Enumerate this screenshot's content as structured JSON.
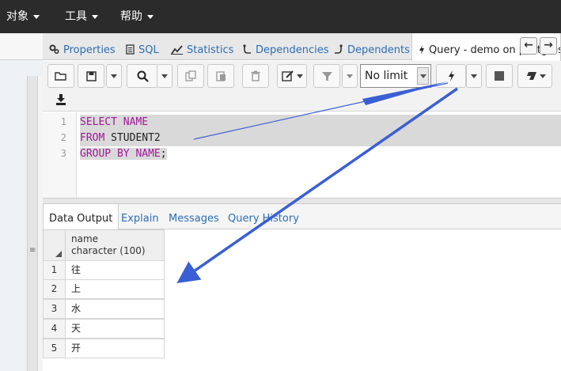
{
  "menu": [
    {
      "label": "对象"
    },
    {
      "label": "工具"
    },
    {
      "label": "帮助"
    }
  ],
  "tabs": [
    {
      "label": "Properties",
      "icon": "properties-icon"
    },
    {
      "label": "SQL",
      "icon": "sql-icon"
    },
    {
      "label": "Statistics",
      "icon": "statistics-icon"
    },
    {
      "label": "Dependencies",
      "icon": "dependencies-icon"
    },
    {
      "label": "Dependents",
      "icon": "dependents-icon"
    },
    {
      "label": "Query - demo on postgres",
      "icon": "query-bolt-icon",
      "active": true
    }
  ],
  "toolbar": {
    "limit_value": "No limit"
  },
  "editor": {
    "lines": [
      {
        "num": "1",
        "tokens": [
          {
            "text": "SELECT",
            "kind": "kw"
          },
          {
            "text": " NAME",
            "kind": "kw"
          }
        ]
      },
      {
        "num": "2",
        "tokens": [
          {
            "text": "FROM",
            "kind": "kw"
          },
          {
            "text": " STUDENT2",
            "kind": "id"
          }
        ]
      },
      {
        "num": "3",
        "tokens": [
          {
            "text": "GROUP BY NAME",
            "kind": "kw"
          },
          {
            "text": ";",
            "kind": "id"
          }
        ]
      }
    ]
  },
  "output_tabs": [
    {
      "label": "Data Output",
      "active": true
    },
    {
      "label": "Explain"
    },
    {
      "label": "Messages"
    },
    {
      "label": "Query History"
    }
  ],
  "grid": {
    "column_name": "name",
    "column_type": "character (100)",
    "rows": [
      {
        "num": "1",
        "value": "往"
      },
      {
        "num": "2",
        "value": "上"
      },
      {
        "num": "3",
        "value": "水"
      },
      {
        "num": "4",
        "value": "天"
      },
      {
        "num": "5",
        "value": "开"
      }
    ]
  },
  "colors": {
    "menubar": "#2b2b2b",
    "link": "#2c6db3",
    "keyword": "#a3169b",
    "annotation_arrow": "#3a5fd4"
  }
}
